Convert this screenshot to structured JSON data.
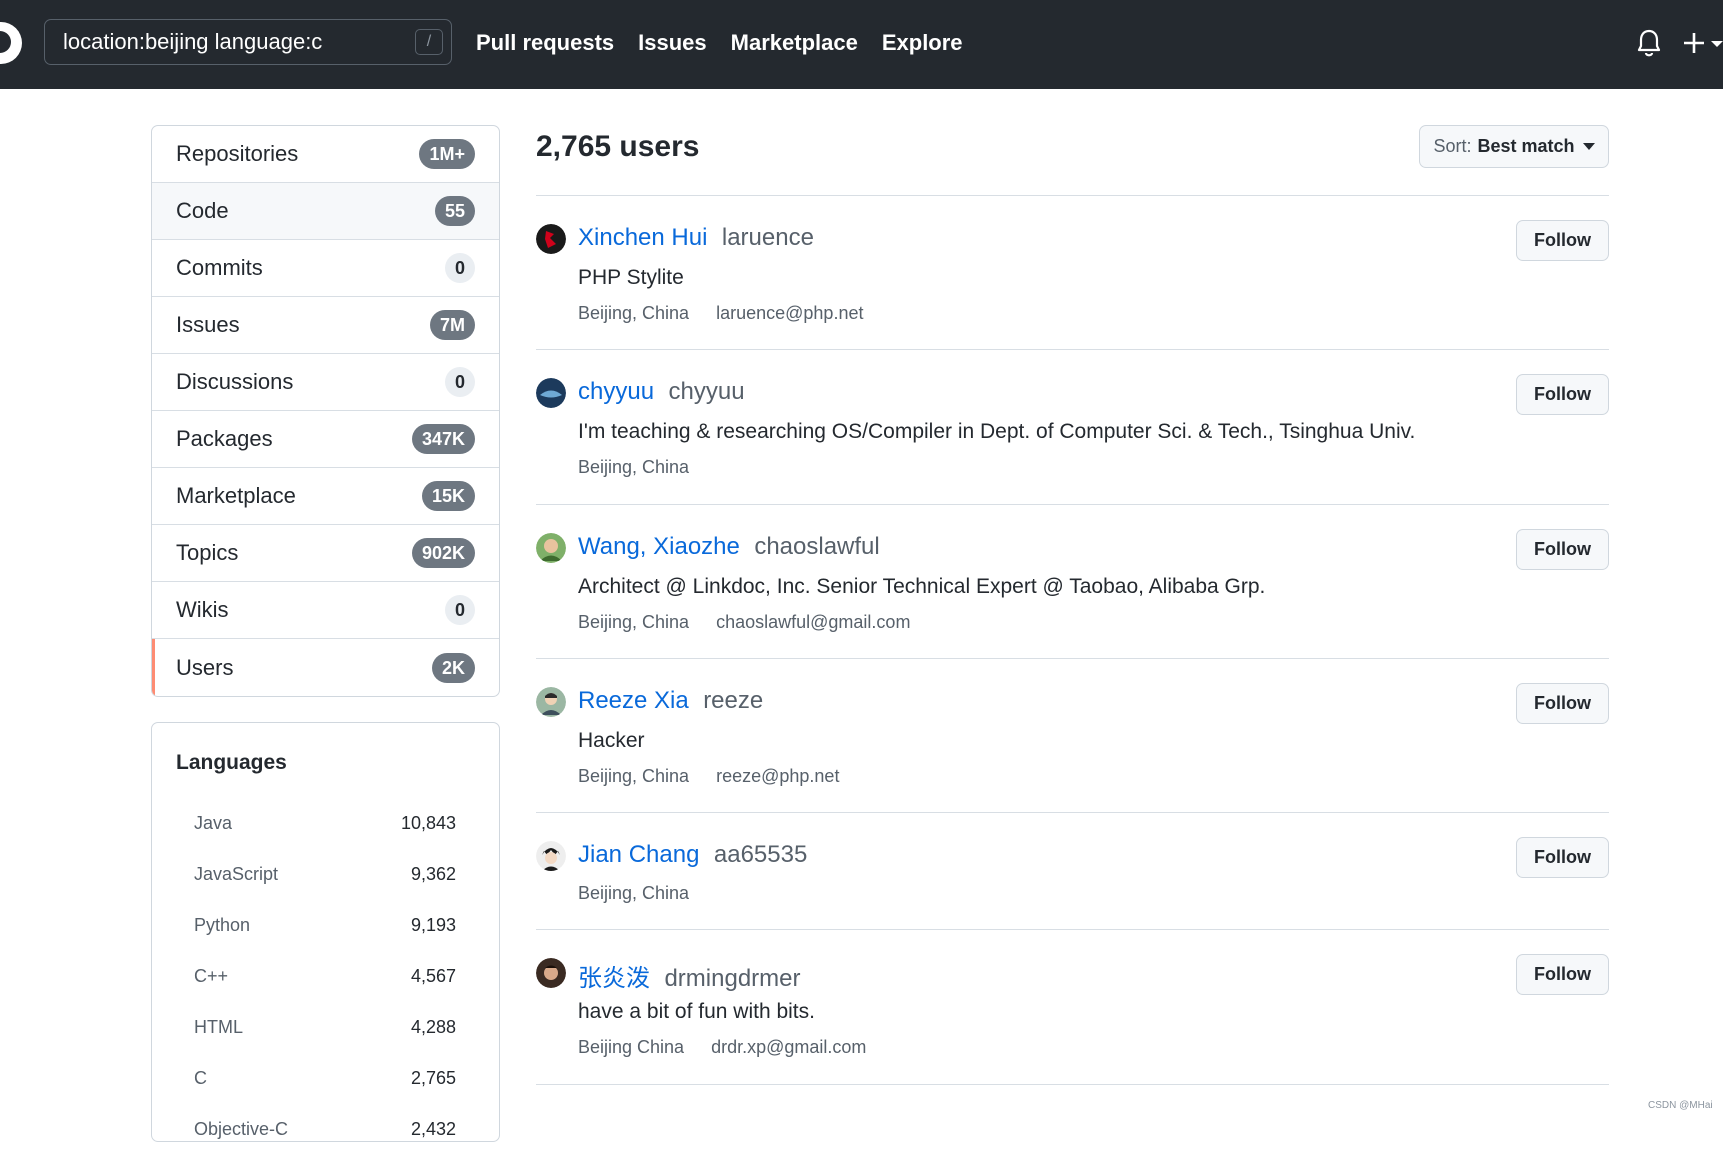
{
  "header": {
    "search_value": "location:beijing language:c",
    "slash_hint": "/",
    "nav": [
      "Pull requests",
      "Issues",
      "Marketplace",
      "Explore"
    ]
  },
  "sidebar": {
    "filters": [
      {
        "label": "Repositories",
        "count": "1M+"
      },
      {
        "label": "Code",
        "count": "55"
      },
      {
        "label": "Commits",
        "count": "0"
      },
      {
        "label": "Issues",
        "count": "7M"
      },
      {
        "label": "Discussions",
        "count": "0"
      },
      {
        "label": "Packages",
        "count": "347K"
      },
      {
        "label": "Marketplace",
        "count": "15K"
      },
      {
        "label": "Topics",
        "count": "902K"
      },
      {
        "label": "Wikis",
        "count": "0"
      },
      {
        "label": "Users",
        "count": "2K"
      }
    ],
    "languages_title": "Languages",
    "languages": [
      {
        "name": "Java",
        "count": "10,843"
      },
      {
        "name": "JavaScript",
        "count": "9,362"
      },
      {
        "name": "Python",
        "count": "9,193"
      },
      {
        "name": "C++",
        "count": "4,567"
      },
      {
        "name": "HTML",
        "count": "4,288"
      },
      {
        "name": "C",
        "count": "2,765"
      },
      {
        "name": "Objective-C",
        "count": "2,432"
      }
    ]
  },
  "main": {
    "results_title": "2,765 users",
    "sort_label": "Sort:",
    "sort_value": "Best match",
    "follow_label": "Follow",
    "users": [
      {
        "name": "Xinchen Hui",
        "login": "laruence",
        "bio": "PHP Stylite",
        "location": "Beijing, China",
        "email": "laruence@php.net"
      },
      {
        "name": "chyyuu",
        "login": "chyyuu",
        "bio": "I'm teaching & researching OS/Compiler in Dept. of Computer Sci. & Tech., Tsinghua Univ.",
        "location": "Beijing, China",
        "email": ""
      },
      {
        "name": "Wang, Xiaozhe",
        "login": "chaoslawful",
        "bio": "Architect @ Linkdoc, Inc. Senior Technical Expert @ Taobao, Alibaba Grp.",
        "location": "Beijing, China",
        "email": "chaoslawful@gmail.com"
      },
      {
        "name": "Reeze Xia",
        "login": "reeze",
        "bio": "Hacker",
        "location": "Beijing, China",
        "email": "reeze@php.net"
      },
      {
        "name": "Jian Chang",
        "login": "aa65535",
        "bio": "",
        "location": "Beijing, China",
        "email": ""
      },
      {
        "name": "张炎泼",
        "login": "drmingdrmer",
        "bio": "have a bit of fun with bits.",
        "location": "Beijing China",
        "email": "drdr.xp@gmail.com"
      }
    ]
  },
  "watermark": "CSDN @MHai"
}
